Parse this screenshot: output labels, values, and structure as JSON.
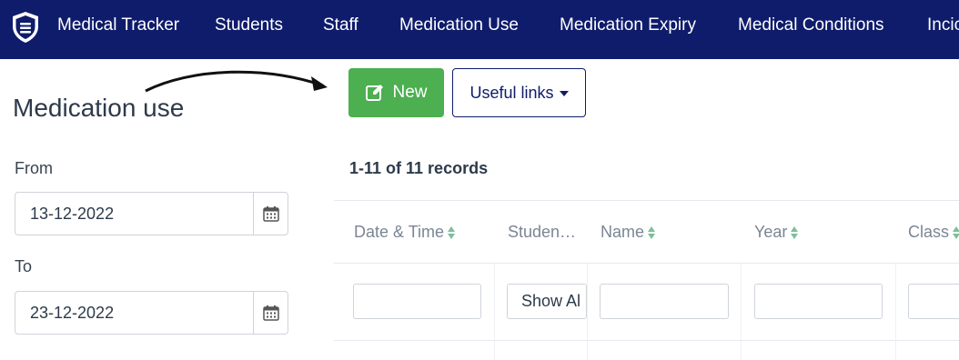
{
  "nav": {
    "brand": "Medical Tracker",
    "items": [
      "Students",
      "Staff",
      "Medication Use",
      "Medication Expiry",
      "Medical Conditions",
      "Incic"
    ]
  },
  "page": {
    "title": "Medication use"
  },
  "toolbar": {
    "new_label": "New",
    "links_label": "Useful links"
  },
  "filters": {
    "from_label": "From",
    "from_value": "13-12-2022",
    "to_label": "To",
    "to_value": "23-12-2022"
  },
  "table": {
    "records_text": "1-11 of 11 records",
    "columns": [
      "Date & Time",
      "Studen…",
      "Name",
      "Year",
      "Class"
    ],
    "student_filter_value": "Show Al"
  },
  "colors": {
    "navbar": "#0f1c6b",
    "new_button": "#4caf50",
    "sort_icon": "#7cbf9a"
  }
}
